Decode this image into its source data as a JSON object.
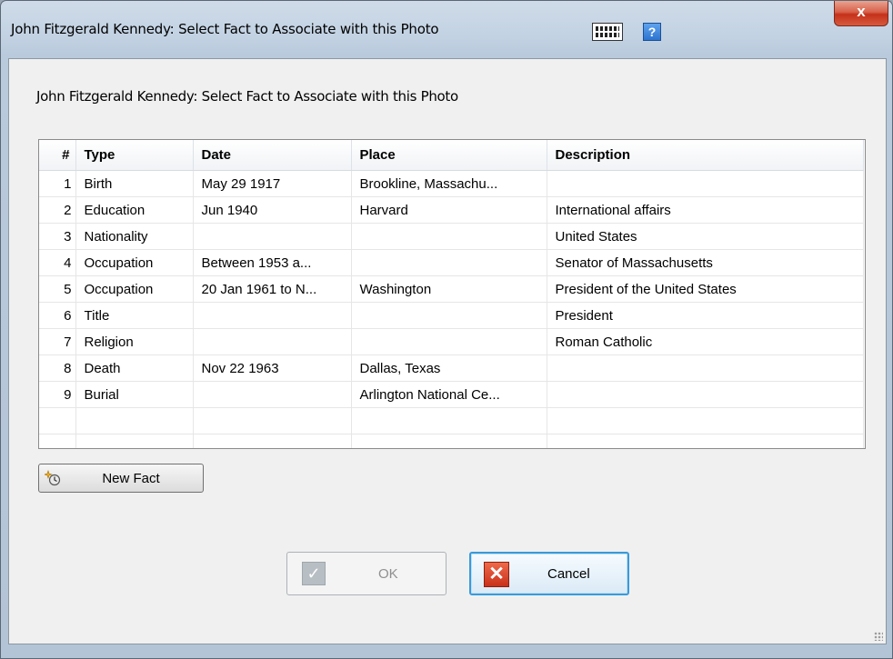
{
  "window": {
    "title": "John Fitzgerald Kennedy: Select Fact to Associate with this Photo",
    "close_label": "x",
    "help_label": "?",
    "accent_close": "#c5311a",
    "accent_focus": "#3a9ad9"
  },
  "dialog": {
    "heading": "John Fitzgerald Kennedy: Select Fact to Associate with this Photo"
  },
  "table": {
    "columns": [
      "#",
      "Type",
      "Date",
      "Place",
      "Description"
    ],
    "rows": [
      {
        "num": "1",
        "type": "Birth",
        "date": "May 29 1917",
        "place": "Brookline, Massachu...",
        "description": ""
      },
      {
        "num": "2",
        "type": "Education",
        "date": "Jun 1940",
        "place": "Harvard",
        "description": "International affairs"
      },
      {
        "num": "3",
        "type": "Nationality",
        "date": "",
        "place": "",
        "description": "United States"
      },
      {
        "num": "4",
        "type": "Occupation",
        "date": "Between 1953 a...",
        "place": "",
        "description": "Senator of Massachusetts"
      },
      {
        "num": "5",
        "type": "Occupation",
        "date": "20 Jan 1961 to N...",
        "place": "Washington",
        "description": "President of the United States"
      },
      {
        "num": "6",
        "type": "Title",
        "date": "",
        "place": "",
        "description": "President"
      },
      {
        "num": "7",
        "type": "Religion",
        "date": "",
        "place": "",
        "description": "Roman Catholic"
      },
      {
        "num": "8",
        "type": "Death",
        "date": "Nov 22 1963",
        "place": "Dallas, Texas",
        "description": ""
      },
      {
        "num": "9",
        "type": "Burial",
        "date": "",
        "place": "Arlington National Ce...",
        "description": ""
      }
    ]
  },
  "buttons": {
    "new_fact": "New Fact",
    "new_fact_icon": "new-fact-icon",
    "ok": "OK",
    "ok_icon": "checkmark-icon",
    "ok_glyph": "✓",
    "cancel": "Cancel",
    "cancel_icon": "cancel-x-icon",
    "cancel_glyph": "✕"
  }
}
